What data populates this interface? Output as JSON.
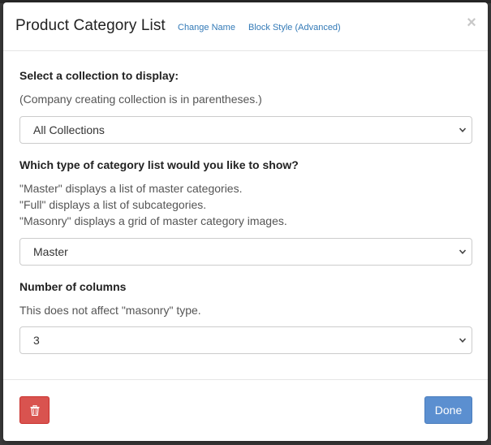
{
  "modal": {
    "title": "Product Category List",
    "links": {
      "change_name": "Change Name",
      "block_style": "Block Style (Advanced)"
    },
    "close_glyph": "×"
  },
  "collection": {
    "label": "Select a collection to display:",
    "help": "(Company creating collection is in parentheses.)",
    "selected": "All Collections"
  },
  "category_type": {
    "label": "Which type of category list would you like to show?",
    "help_lines": [
      "\"Master\" displays a list of master categories.",
      "\"Full\" displays a list of subcategories.",
      "\"Masonry\" displays a grid of master category images."
    ],
    "selected": "Master"
  },
  "columns": {
    "label": "Number of columns",
    "help": "This does not affect \"masonry\" type.",
    "selected": "3"
  },
  "footer": {
    "delete_icon": "trash-icon",
    "done_label": "Done"
  },
  "colors": {
    "link": "#337ab7",
    "danger": "#d9534f",
    "primary": "#5b8fd0"
  }
}
